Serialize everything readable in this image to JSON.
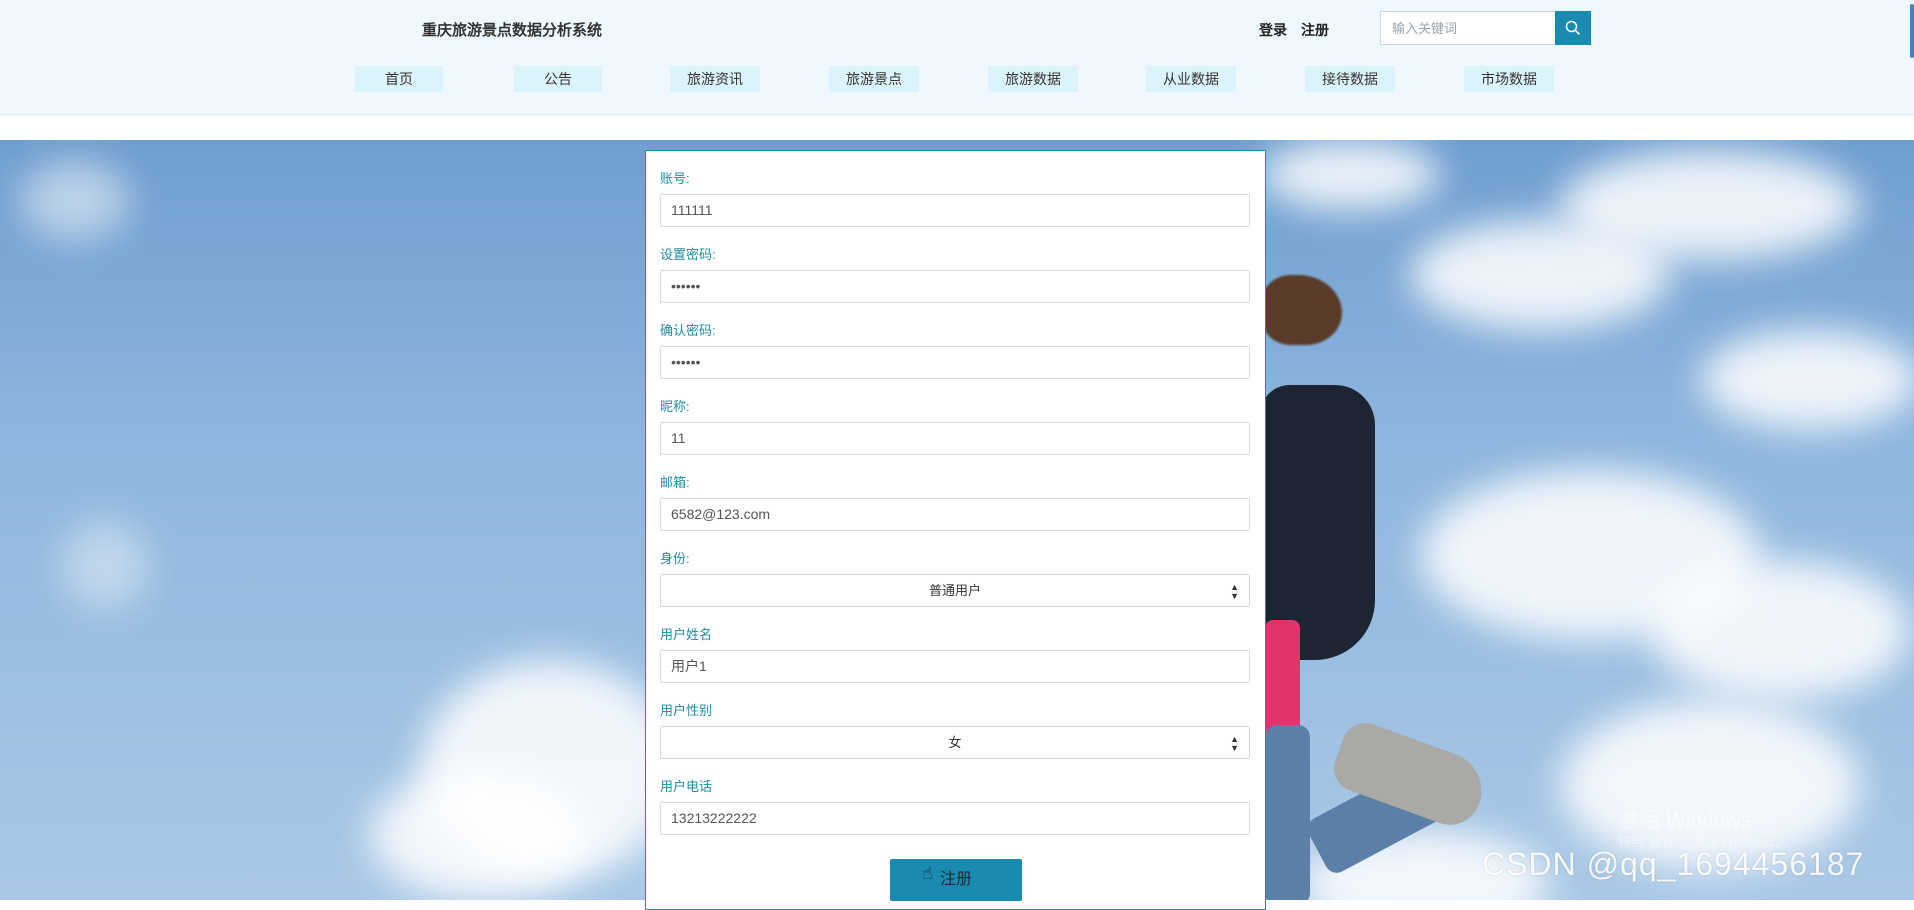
{
  "header": {
    "site_title": "重庆旅游景点数据分析系统",
    "login_label": "登录",
    "register_label": "注册",
    "search_placeholder": "输入关键词"
  },
  "nav": [
    {
      "label": "首页"
    },
    {
      "label": "公告"
    },
    {
      "label": "旅游资讯"
    },
    {
      "label": "旅游景点"
    },
    {
      "label": "旅游数据"
    },
    {
      "label": "从业数据"
    },
    {
      "label": "接待数据"
    },
    {
      "label": "市场数据"
    }
  ],
  "form": {
    "account_label": "账号:",
    "account_value": "111111",
    "password_label": "设置密码:",
    "password_value": "••••••",
    "confirm_label": "确认密码:",
    "confirm_value": "••••••",
    "nickname_label": "昵称:",
    "nickname_value": "11",
    "email_label": "邮箱:",
    "email_value": "6582@123.com",
    "role_label": "身份:",
    "role_value": "普通用户",
    "username_label": "用户姓名",
    "username_value": "用户1",
    "gender_label": "用户性别",
    "gender_value": "女",
    "phone_label": "用户电话",
    "phone_value": "13213222222",
    "submit_label": "注册"
  },
  "watermarks": {
    "windows_line1": "激活 Windows",
    "windows_line2": "转到\"设置\"以激活 Windows。",
    "csdn": "CSDN @qq_1694456187"
  },
  "colors": {
    "accent": "#1a8bb0",
    "label": "#1d8ea3",
    "header_bg": "#eef8fe",
    "nav_bg": "#dbf3fb"
  }
}
